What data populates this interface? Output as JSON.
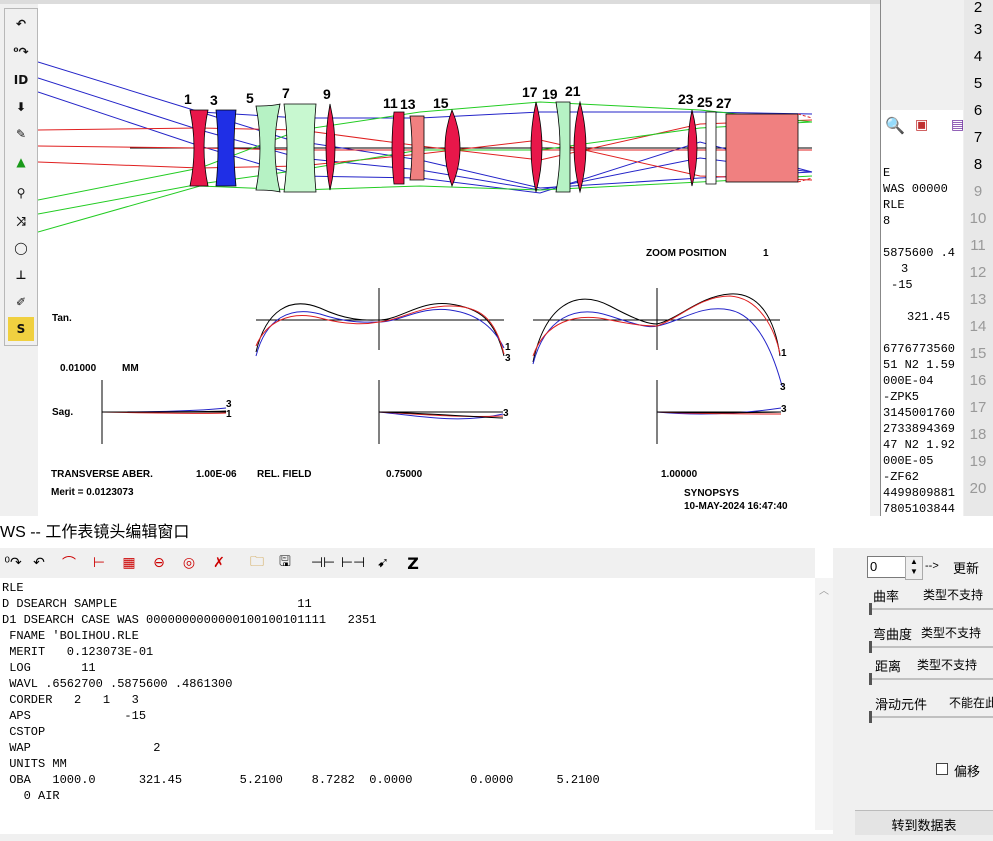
{
  "canvas": {
    "surface_labels": [
      "1",
      "3",
      "5",
      "7",
      "9",
      "11",
      "13",
      "15",
      "17",
      "19",
      "21",
      "23",
      "25",
      "27"
    ],
    "zoom_label": "ZOOM POSITION",
    "zoom_value": "1",
    "tan_label": "Tan.",
    "sag_label": "Sag.",
    "scale_value": "0.01000",
    "scale_unit": "MM",
    "transverse_label": "TRANSVERSE ABER.",
    "transverse_value": "1.00E-06",
    "rel_field_label": "REL. FIELD",
    "field_1": "0.75000",
    "field_2": "1.00000",
    "merit": "Merit = 0.0123073",
    "software": "SYNOPSYS",
    "datetime": "10-MAY-2024 16:47:40",
    "curve_labels": {
      "one": "1",
      "three": "3"
    }
  },
  "left_toolbar": {
    "buttons": [
      "undo-icon",
      "redo-icon",
      "ID",
      "download-icon",
      "pen-icon",
      "triangle-icon",
      "lens-add-icon",
      "lens-flip-icon",
      "circle-icon",
      "split-icon",
      "pencil-icon",
      "s-icon"
    ],
    "id_label": "ID"
  },
  "right_pane": {
    "lines": [
      "E",
      "WAS 00000",
      "RLE",
      "8",
      "",
      "5875600 .4",
      "3",
      "-15",
      "",
      "321.45",
      "",
      "6776773560",
      "51 N2 1.59",
      "000E-04",
      "-ZPK5",
      "3145001760",
      "2733894369",
      "47 N2 1.92",
      "000E-05",
      "-ZF62",
      "4499809881",
      "7805103844"
    ]
  },
  "number_column": [
    "2",
    "3",
    "4",
    "5",
    "6",
    "7",
    "8",
    "9",
    "10",
    "11",
    "12",
    "13",
    "14",
    "15",
    "16",
    "17",
    "18",
    "19",
    "20"
  ],
  "bottom": {
    "title": "WS -- 工作表镜头编辑窗口",
    "text_lines": [
      "RLE",
      "D DSEARCH SAMPLE                         11",
      "D1 DSEARCH CASE WAS 0000000000000100100101111   2351",
      " FNAME 'BOLIHOU.RLE",
      " MERIT   0.123073E-01",
      " LOG       11",
      " WAVL .6562700 .5875600 .4861300",
      " CORDER   2   1   3",
      " APS             -15",
      " CSTOP",
      " WAP                 2",
      " UNITS MM",
      " OBA   1000.0      321.45        5.2100    8.7282  0.0000        0.0000      5.2100",
      "   0 AIR"
    ],
    "toolbar_z": "Z",
    "side": {
      "spin_value": "0",
      "arrow": "-->",
      "update_button": "更新",
      "curvature": "曲率",
      "type_unsupported": "类型不支持",
      "bend": "弯曲度",
      "distance": "距离",
      "slide": "滑动元件",
      "cannot": "不能在此",
      "offset": "偏移",
      "goto": "转到数据表"
    }
  },
  "colors": {
    "red_lens": "#e8174a",
    "blue_lens": "#1f2fe6",
    "green_lens": "#b6f2c4",
    "pink_lens": "#f08080",
    "ray_blue": "#2323c8",
    "ray_red": "#e02020",
    "ray_green": "#22cc22"
  }
}
